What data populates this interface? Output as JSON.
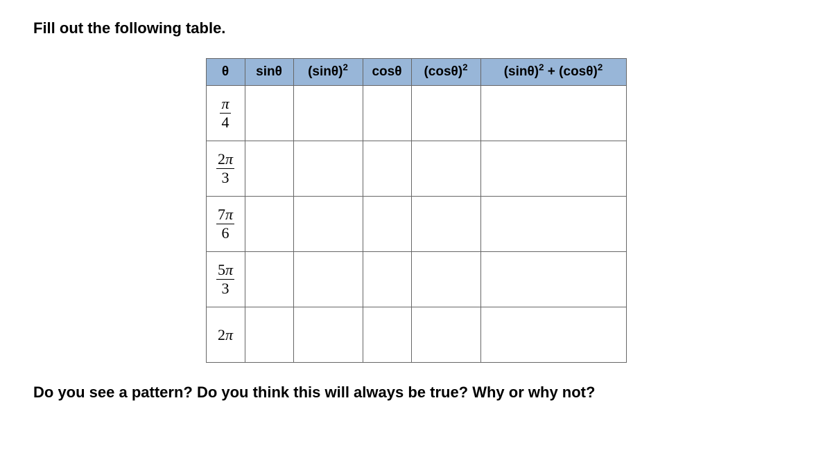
{
  "instruction_top": "Fill out the following table.",
  "headers": {
    "theta": "θ",
    "sin": "sinθ",
    "sin2": "(sinθ)²",
    "cos": "cosθ",
    "cos2": "(cosθ)²",
    "sum": "(sinθ)² + (cosθ)²"
  },
  "rows": [
    {
      "numerator": "π",
      "denominator": "4",
      "is_fraction": true,
      "sin": "",
      "sin2": "",
      "cos": "",
      "cos2": "",
      "sum": ""
    },
    {
      "numerator": "2π",
      "denominator": "3",
      "is_fraction": true,
      "sin": "",
      "sin2": "",
      "cos": "",
      "cos2": "",
      "sum": ""
    },
    {
      "numerator": "7π",
      "denominator": "6",
      "is_fraction": true,
      "sin": "",
      "sin2": "",
      "cos": "",
      "cos2": "",
      "sum": ""
    },
    {
      "numerator": "5π",
      "denominator": "3",
      "is_fraction": true,
      "sin": "",
      "sin2": "",
      "cos": "",
      "cos2": "",
      "sum": ""
    },
    {
      "numerator": "2π",
      "denominator": "",
      "is_fraction": false,
      "sin": "",
      "sin2": "",
      "cos": "",
      "cos2": "",
      "sum": ""
    }
  ],
  "question_bottom": "Do you see a pattern? Do you think this will always be true? Why or why not?"
}
